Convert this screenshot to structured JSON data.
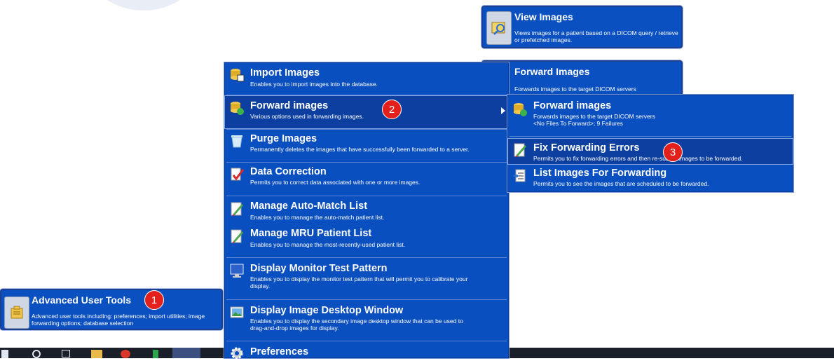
{
  "tiles": {
    "view_images": {
      "title": "View Images",
      "desc": "Views images for a patient based on a DICOM query / retrieve or prefetched images."
    },
    "forward_images": {
      "title": "Forward Images",
      "desc": "Forwards images to the target DICOM servers",
      "desc2": "<No Files To Forward>; 9 Failures"
    },
    "advanced_user_tools": {
      "title": "Advanced User Tools",
      "desc": "Advanced user tools including: preferences; import utilities; image forwarding options; database selection"
    }
  },
  "main_menu": {
    "items": [
      {
        "label": "Import Images",
        "desc": "Enables you to import images into the database."
      },
      {
        "label": "Forward images",
        "desc": "Various options used in forwarding images."
      },
      {
        "label": "Purge Images",
        "desc": "Permanently deletes the images that have successfully been forwarded to a server."
      },
      {
        "label": "Data Correction",
        "desc": "Permits you to correct data associated with one or more images."
      },
      {
        "label": "Manage Auto-Match List",
        "desc": "Enables you to manage the auto-match patient list."
      },
      {
        "label": "Manage MRU Patient List",
        "desc": "Enables you to manage the most-recently-used patient list."
      },
      {
        "label": "Display Monitor Test Pattern",
        "desc": "Enables you to display the monitor test pattern that will permit you to calibrate your",
        "desc2": "display."
      },
      {
        "label": "Display Image Desktop Window",
        "desc": "Enables you to display the secondary image desktop window that can be used to",
        "desc2": "drag-and-drop images for display."
      },
      {
        "label": "Preferences",
        "desc": ""
      }
    ]
  },
  "sub_menu": {
    "items": [
      {
        "label": "Forward images",
        "desc": "Forwards images to the target DICOM servers",
        "desc2": "<No Files To Forward>; 9 Failures"
      },
      {
        "label": "Fix Forwarding Errors",
        "desc": "Permits you to fix forwarding errors and then re-submit images to be forwarded."
      },
      {
        "label": "List Images For Forwarding",
        "desc": "Permits you to see the images that are scheduled to be forwarded."
      }
    ]
  },
  "badges": {
    "one": "1",
    "two": "2",
    "three": "3"
  },
  "colors": {
    "menu_blue": "#0a4fbf",
    "badge_red": "#e3201b"
  }
}
